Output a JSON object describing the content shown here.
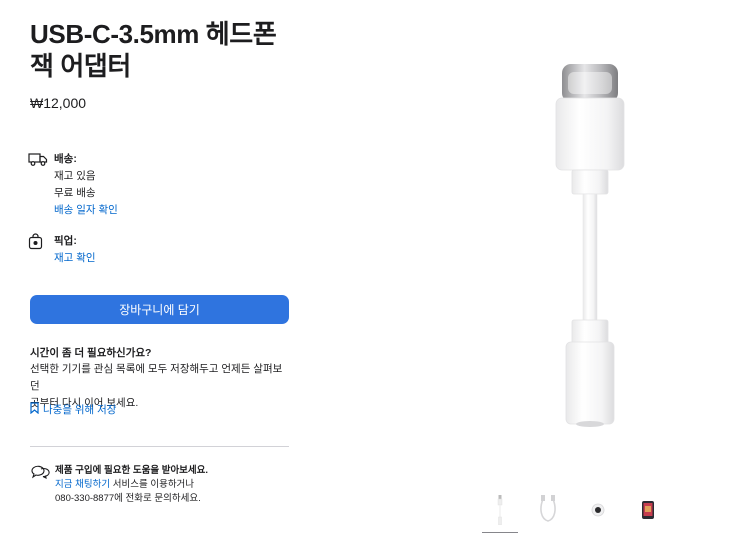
{
  "product": {
    "title": "USB-C-3.5mm 헤드폰 잭 어댑터",
    "price": "₩12,000"
  },
  "delivery": {
    "label": "배송:",
    "stock": "재고 있음",
    "shipping": "무료 배송",
    "date_link": "배송 일자 확인"
  },
  "pickup": {
    "label": "픽업:",
    "stock_link": "재고 확인"
  },
  "cart_button": "장바구니에 담기",
  "save": {
    "title": "시간이 좀 더 필요하신가요?",
    "line1": "선택한 기기를 관심 목록에 모두 저장해두고 언제든 살펴보던",
    "line2": "곳부터 다시 이어 보세요.",
    "link": "나중을 위해 저장"
  },
  "help": {
    "title": "제품 구입에 필요한 도움을 받아보세요.",
    "chat_link": "지금 채팅하기",
    "chat_suffix": " 서비스를 이용하거나",
    "phone_line": "080-330-8877에 전화로 문의하세요."
  },
  "icons": {
    "delivery": "truck-icon",
    "pickup": "store-bag-icon",
    "bookmark": "bookmark-icon",
    "chat": "chat-bubbles-icon"
  },
  "gallery": {
    "thumbnails": [
      "adapter-front",
      "adapter-side",
      "adapter-jack",
      "adapter-with-phone"
    ],
    "selected_index": 0
  },
  "colors": {
    "accent": "#2f74df",
    "link": "#0066cc",
    "text": "#1d1d1f"
  }
}
